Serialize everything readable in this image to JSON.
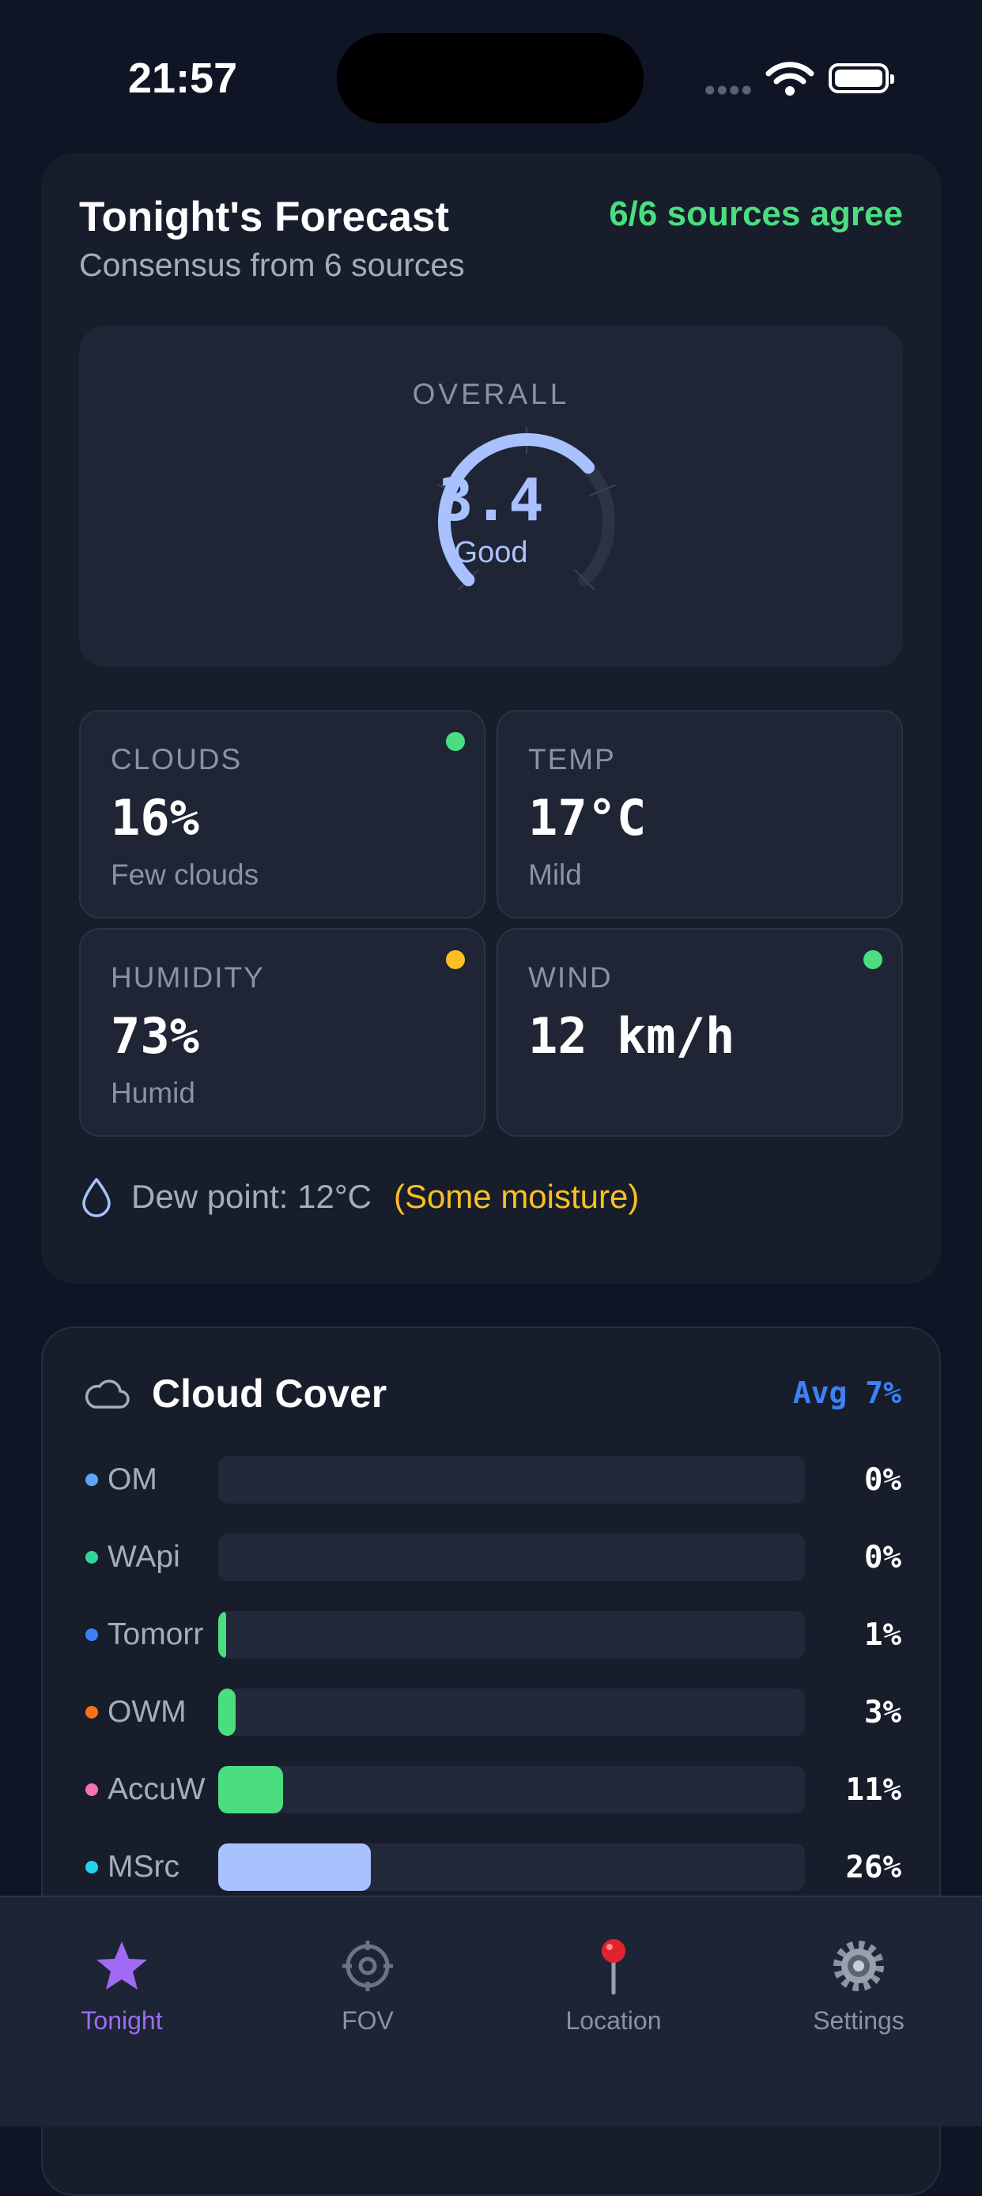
{
  "status_bar": {
    "time": "21:57"
  },
  "forecast": {
    "title": "Tonight's Forecast",
    "subtitle": "Consensus from 6 sources",
    "agreement": "6/6 sources agree",
    "overall": {
      "label": "OVERALL",
      "score": "3.4",
      "rating": "Good",
      "score_fraction": 0.68
    },
    "metrics": [
      {
        "label": "CLOUDS",
        "value": "16%",
        "sub": "Few clouds",
        "status_color": "#4ade80"
      },
      {
        "label": "TEMP",
        "value": "17°C",
        "sub": "Mild",
        "status_color": null
      },
      {
        "label": "HUMIDITY",
        "value": "73%",
        "sub": "Humid",
        "status_color": "#fbbf24"
      },
      {
        "label": "WIND",
        "value": "12 km/h",
        "sub": "",
        "status_color": "#4ade80"
      }
    ],
    "dew_point": {
      "text": "Dew point: 12°C",
      "note": "(Some moisture)"
    }
  },
  "cloud_cover": {
    "title": "Cloud Cover",
    "average": "Avg 7%",
    "sources": [
      {
        "name": "OM",
        "value": "0%",
        "percent": 0,
        "dot_color": "#60a5fa",
        "bar_color": "#4ade80"
      },
      {
        "name": "WApi",
        "value": "0%",
        "percent": 0,
        "dot_color": "#34d399",
        "bar_color": "#4ade80"
      },
      {
        "name": "Tomorr",
        "value": "1%",
        "percent": 1,
        "dot_color": "#3b82f6",
        "bar_color": "#4ade80"
      },
      {
        "name": "OWM",
        "value": "3%",
        "percent": 3,
        "dot_color": "#f97316",
        "bar_color": "#4ade80"
      },
      {
        "name": "AccuW",
        "value": "11%",
        "percent": 11,
        "dot_color": "#f472b6",
        "bar_color": "#4ade80"
      },
      {
        "name": "MSrc",
        "value": "26%",
        "percent": 26,
        "dot_color": "#22d3ee",
        "bar_color": "#a9c2ff"
      }
    ]
  },
  "tabs": [
    {
      "label": "Tonight",
      "icon": "star-icon",
      "active": true
    },
    {
      "label": "FOV",
      "icon": "crosshair-icon",
      "active": false
    },
    {
      "label": "Location",
      "icon": "pin-icon",
      "active": false
    },
    {
      "label": "Settings",
      "icon": "gear-icon",
      "active": false
    }
  ],
  "colors": {
    "accent": "#a06bf2",
    "good": "#4ade80",
    "warn": "#fbbf24",
    "info": "#3b82f6",
    "gauge": "#a9c2ff"
  }
}
